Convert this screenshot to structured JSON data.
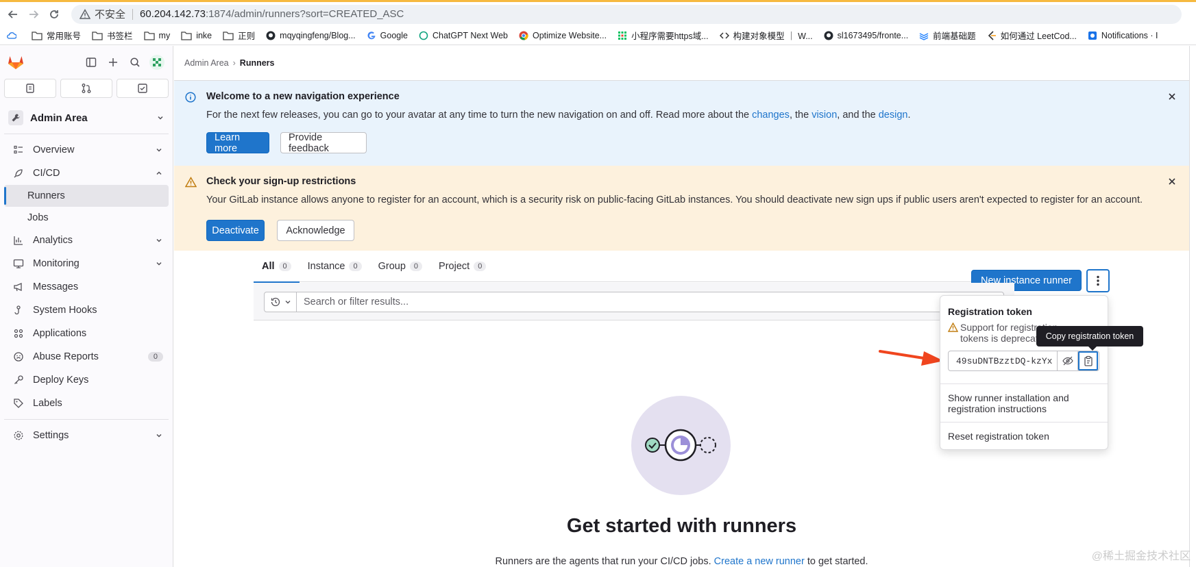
{
  "browser": {
    "insecure_label": "不安全",
    "url_host": "60.204.142.73",
    "url_path": ":1874/admin/runners?sort=CREATED_ASC"
  },
  "bookmarks": [
    {
      "label": "常用账号",
      "icon": "folder-icon"
    },
    {
      "label": "书签栏",
      "icon": "folder-icon"
    },
    {
      "label": "my",
      "icon": "folder-icon"
    },
    {
      "label": "inke",
      "icon": "folder-icon"
    },
    {
      "label": "正则",
      "icon": "folder-icon"
    },
    {
      "label": "mqyqingfeng/Blog...",
      "icon": "github-icon"
    },
    {
      "label": "Google",
      "icon": "google-icon"
    },
    {
      "label": "ChatGPT Next Web",
      "icon": "openai-icon"
    },
    {
      "label": "Optimize Website...",
      "icon": "chrome-icon"
    },
    {
      "label": "小程序需要https域...",
      "icon": "grid-icon"
    },
    {
      "label": "构建对象模型 ｜ W...",
      "icon": "code-icon"
    },
    {
      "label": "sl1673495/fronte...",
      "icon": "github-icon"
    },
    {
      "label": "前端基础题",
      "icon": "stack-icon"
    },
    {
      "label": "如何通过 LeetCod...",
      "icon": "leetcode-icon"
    },
    {
      "label": "Notifications · I",
      "icon": "notif-icon"
    }
  ],
  "sidebar": {
    "context": "Admin Area",
    "items": [
      {
        "label": "Overview",
        "icon": "overview-icon"
      },
      {
        "label": "CI/CD",
        "icon": "rocket-icon"
      },
      {
        "label": "Runners"
      },
      {
        "label": "Jobs"
      },
      {
        "label": "Analytics",
        "icon": "chart-icon"
      },
      {
        "label": "Monitoring",
        "icon": "monitor-icon"
      },
      {
        "label": "Messages",
        "icon": "bullhorn-icon"
      },
      {
        "label": "System Hooks",
        "icon": "hook-icon"
      },
      {
        "label": "Applications",
        "icon": "apps-icon"
      },
      {
        "label": "Abuse Reports",
        "icon": "abuse-icon",
        "badge": "0"
      },
      {
        "label": "Deploy Keys",
        "icon": "key-icon"
      },
      {
        "label": "Labels",
        "icon": "label-icon"
      },
      {
        "label": "Settings",
        "icon": "settings-icon"
      }
    ]
  },
  "breadcrumb": {
    "parent": "Admin Area",
    "current": "Runners"
  },
  "info_banner": {
    "title": "Welcome to a new navigation experience",
    "body_prefix": "For the next few releases, you can go to your avatar at any time to turn the new navigation on and off. Read more about the ",
    "link_changes": "changes",
    "mid1": ", the ",
    "link_vision": "vision",
    "mid2": ", and the ",
    "link_design": "design",
    "suffix": ".",
    "learn_more": "Learn more",
    "feedback": "Provide feedback"
  },
  "warn_banner": {
    "title": "Check your sign-up restrictions",
    "body": "Your GitLab instance allows anyone to register for an account, which is a security risk on public-facing GitLab instances. You should deactivate new sign ups if public users aren't expected to register for an account.",
    "deactivate": "Deactivate",
    "acknowledge": "Acknowledge"
  },
  "tabs": [
    {
      "label": "All",
      "count": "0"
    },
    {
      "label": "Instance",
      "count": "0"
    },
    {
      "label": "Group",
      "count": "0"
    },
    {
      "label": "Project",
      "count": "0"
    }
  ],
  "new_runner": "New instance runner",
  "search": {
    "placeholder": "Search or filter results..."
  },
  "dropdown": {
    "title": "Registration token",
    "warning": "Support for registration tokens is deprecated",
    "token": "49suDNTBzztDQ-kzYx",
    "show_instructions": "Show runner installation and registration instructions",
    "reset": "Reset registration token"
  },
  "tooltip": "Copy registration token",
  "empty": {
    "title": "Get started with runners",
    "body_prefix": "Runners are the agents that run your CI/CD jobs. ",
    "link": "Create a new runner",
    "body_suffix": " to get started."
  },
  "watermark": "@稀土掘金技术社区",
  "colors": {
    "accent": "#1f75cb",
    "info_bg": "#e9f3fc",
    "warn_bg": "#fdf1dd",
    "annotation_arrow": "#f0451e"
  }
}
